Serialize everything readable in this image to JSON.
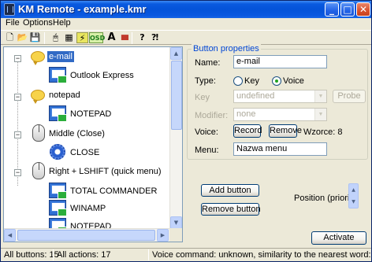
{
  "window": {
    "title": "KM Remote - example.kmr"
  },
  "titlebar_buttons": {
    "minimize": "_",
    "maximize": "□",
    "close": "✕"
  },
  "menu": {
    "file": "File",
    "options": "Options",
    "help": "Help"
  },
  "toolbar": {
    "items": [
      {
        "name": "new-icon",
        "glyph": "🗋"
      },
      {
        "name": "open-folder-icon",
        "glyph": "📂"
      },
      {
        "name": "save-icon",
        "glyph": "💾"
      },
      {
        "name": "mouse-icon",
        "glyph": "🖱"
      },
      {
        "name": "grid-icon",
        "glyph": "▦"
      },
      {
        "name": "lightning-icon",
        "glyph": "⚡"
      },
      {
        "name": "osd-icon",
        "glyph": "OSD"
      },
      {
        "name": "font-icon",
        "glyph": "A"
      },
      {
        "name": "color-bars-icon",
        "glyph": "▮▮▮"
      },
      {
        "name": "help-icon",
        "glyph": "?"
      },
      {
        "name": "context-help-icon",
        "glyph": "⁈"
      }
    ]
  },
  "tree": {
    "nodes": [
      {
        "label": "e-mail",
        "selected": true,
        "expander": "−",
        "icon": "speech-bubble-icon"
      },
      {
        "label": "Outlook Express",
        "icon": "application-icon"
      },
      {
        "label": "notepad",
        "expander": "−",
        "icon": "speech-bubble-icon"
      },
      {
        "label": "NOTEPAD",
        "icon": "application-icon"
      },
      {
        "label": "Middle (Close)",
        "expander": "−",
        "icon": "mouse-icon"
      },
      {
        "label": "CLOSE",
        "icon": "gear-icon"
      },
      {
        "label": "Right + LSHIFT (quick menu)",
        "expander": "−",
        "icon": "mouse-icon"
      },
      {
        "label": "TOTAL COMMANDER",
        "icon": "application-icon"
      },
      {
        "label": "WINAMP",
        "icon": "application-icon"
      },
      {
        "label": "NOTEPAD",
        "icon": "application-icon"
      }
    ]
  },
  "properties": {
    "group_title": "Button properties",
    "name_label": "Name:",
    "name_value": "e-mail",
    "type_label": "Type:",
    "type_options": {
      "key": "Key",
      "voice": "Voice"
    },
    "type_selected": "voice",
    "key_label": "Key",
    "key_value": "undefined",
    "probe_button": "Probe",
    "modifier_label": "Modifier:",
    "modifier_value": "none",
    "voice_label": "Voice:",
    "record_button": "Record",
    "remove_button": "Remove",
    "wzorce": "Wzorce: 8",
    "menu_label": "Menu:",
    "menu_value": "Nazwa menu"
  },
  "actions": {
    "add_button": "Add button",
    "remove_button": "Remove button",
    "position_label": "Position (priority)",
    "activate_button": "Activate"
  },
  "status": {
    "all_buttons": "All buttons: 15",
    "all_actions": "All actions: 17",
    "voice_command": "Voice command: unknown, similarity to the nearest word: 505"
  }
}
